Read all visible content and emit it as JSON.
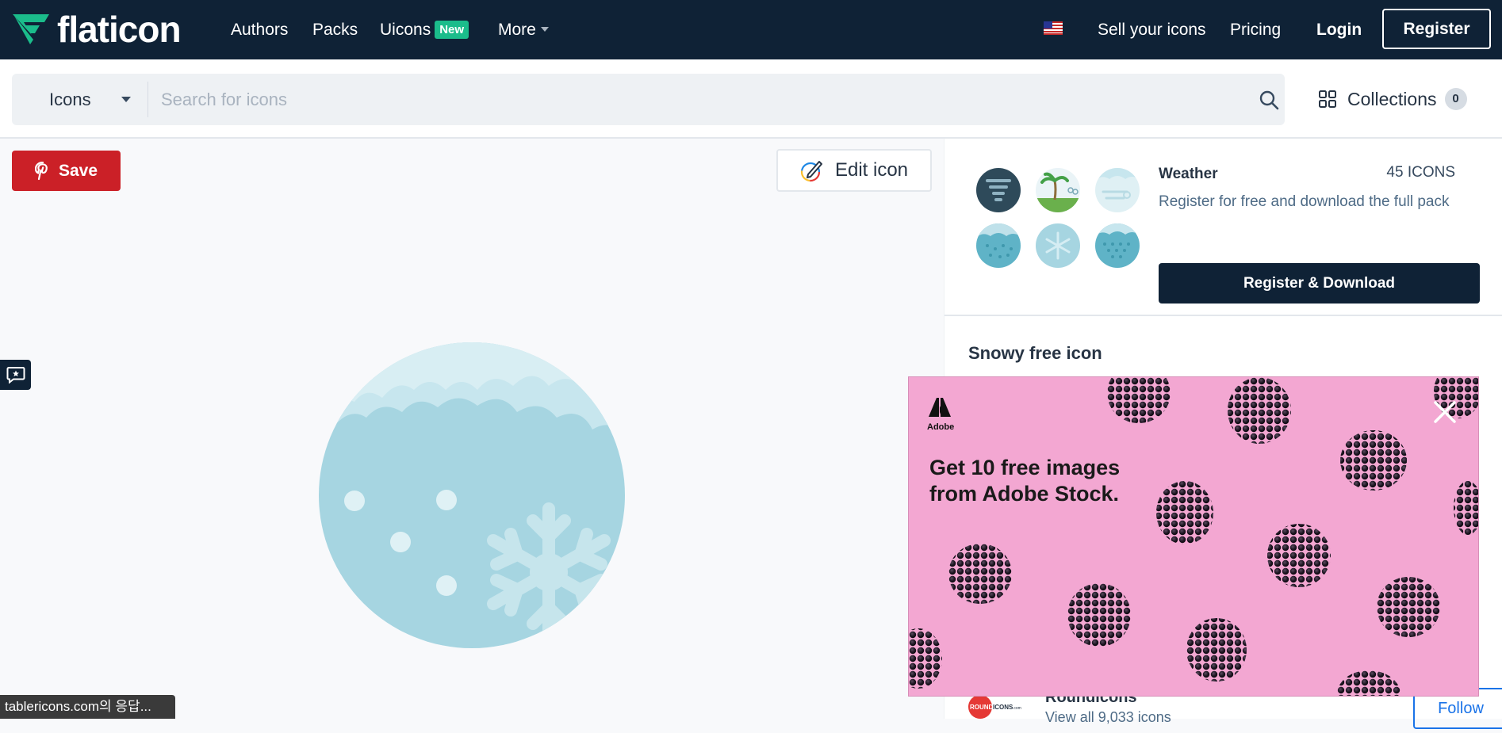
{
  "header": {
    "logo_text": "flaticon",
    "nav": {
      "authors": "Authors",
      "packs": "Packs",
      "uicons": "Uicons",
      "uicons_badge": "New",
      "more": "More"
    },
    "sell": "Sell your icons",
    "pricing": "Pricing",
    "login": "Login",
    "register": "Register"
  },
  "search": {
    "category": "Icons",
    "placeholder": "Search for icons",
    "collections_label": "Collections",
    "collections_count": "0"
  },
  "actions": {
    "save": "Save",
    "edit_icon": "Edit icon"
  },
  "pack": {
    "name": "Weather",
    "count": "45 ICONS",
    "description": "Register for free and download the full pack",
    "button": "Register & Download"
  },
  "icon": {
    "title": "Snowy free icon"
  },
  "author": {
    "logo_text_1": "ROUND",
    "logo_text_2": "ICONS",
    "logo_text_3": ".com",
    "name": "Roundicons",
    "view_all": "View all 9,033 icons",
    "follow": "Follow"
  },
  "ad": {
    "brand": "Adobe",
    "headline": "Get 10 free images from Adobe Stock."
  },
  "status_tooltip": "tablericons.com의 응답...",
  "colors": {
    "header_bg": "#0f2236",
    "accent_green": "#1bbc8b",
    "pinterest_red": "#cb2027",
    "ad_bg": "#f3a7d2"
  }
}
